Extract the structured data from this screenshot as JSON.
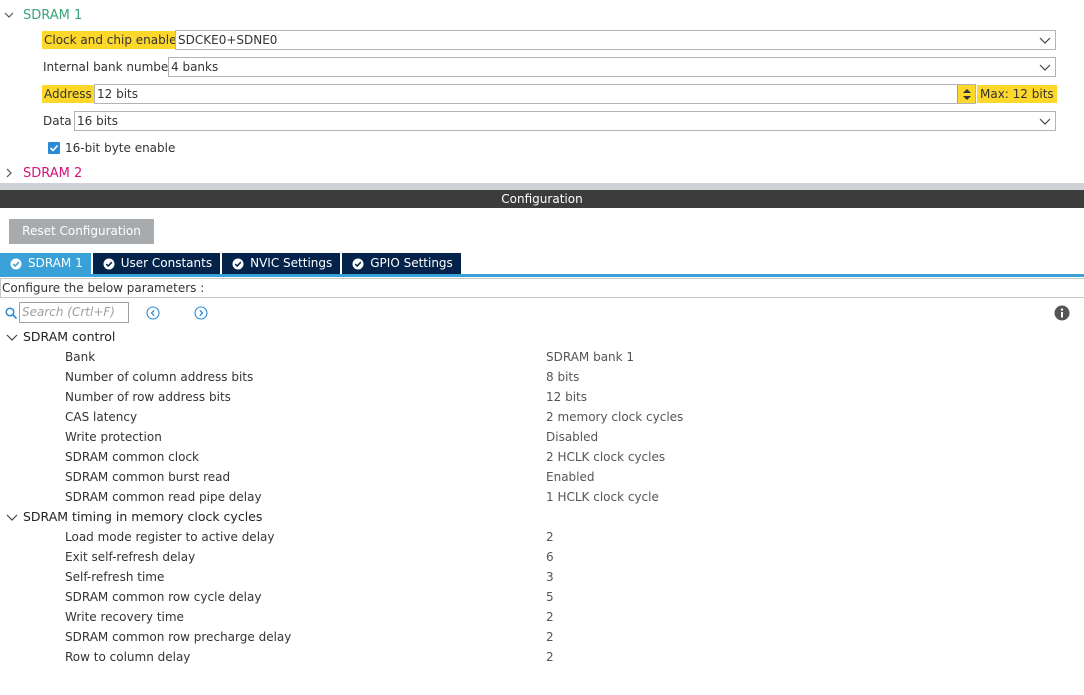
{
  "mode": {
    "sdram1": {
      "title": "SDRAM 1",
      "clock_label": "Clock and chip enable",
      "clock_value": "SDCKE0+SDNE0",
      "bank_label": "Internal bank number",
      "bank_value": "4 banks",
      "address_label": "Address",
      "address_value": "12 bits",
      "address_max": "Max: 12 bits",
      "data_label": "Data",
      "data_value": "16 bits",
      "byte_enable_label": "16-bit byte enable",
      "byte_enable_checked": true
    },
    "sdram2": {
      "title": "SDRAM 2"
    }
  },
  "config": {
    "title": "Configuration",
    "reset_label": "Reset Configuration",
    "tabs": [
      {
        "label": "SDRAM 1",
        "active": true
      },
      {
        "label": "User Constants",
        "active": false
      },
      {
        "label": "NVIC Settings",
        "active": false
      },
      {
        "label": "GPIO Settings",
        "active": false
      }
    ],
    "instruction": "Configure the below parameters :",
    "search_placeholder": "Search (Crtl+F)"
  },
  "groups": [
    {
      "title": "SDRAM control",
      "params": [
        {
          "name": "Bank",
          "value": "SDRAM bank 1"
        },
        {
          "name": "Number of column address bits",
          "value": "8 bits"
        },
        {
          "name": "Number of row address bits",
          "value": "12 bits"
        },
        {
          "name": "CAS latency",
          "value": "2 memory clock cycles"
        },
        {
          "name": "Write protection",
          "value": "Disabled"
        },
        {
          "name": "SDRAM common clock",
          "value": "2 HCLK clock cycles"
        },
        {
          "name": "SDRAM common burst read",
          "value": "Enabled"
        },
        {
          "name": "SDRAM common read pipe delay",
          "value": "1 HCLK clock cycle"
        }
      ]
    },
    {
      "title": "SDRAM timing in memory clock cycles",
      "params": [
        {
          "name": "Load mode register to active delay",
          "value": "2"
        },
        {
          "name": "Exit self-refresh delay",
          "value": "6"
        },
        {
          "name": "Self-refresh time",
          "value": "3"
        },
        {
          "name": "SDRAM common row cycle delay",
          "value": "5"
        },
        {
          "name": "Write recovery time",
          "value": "2"
        },
        {
          "name": "SDRAM common row precharge delay",
          "value": "2"
        },
        {
          "name": "Row to column delay",
          "value": "2"
        }
      ]
    }
  ],
  "colors": {
    "highlight": "#fdd72a",
    "sdram1_title": "#3aa37a",
    "sdram2_title": "#d4147a",
    "tab_active": "#39a0d8",
    "tab_inactive": "#03234b"
  }
}
